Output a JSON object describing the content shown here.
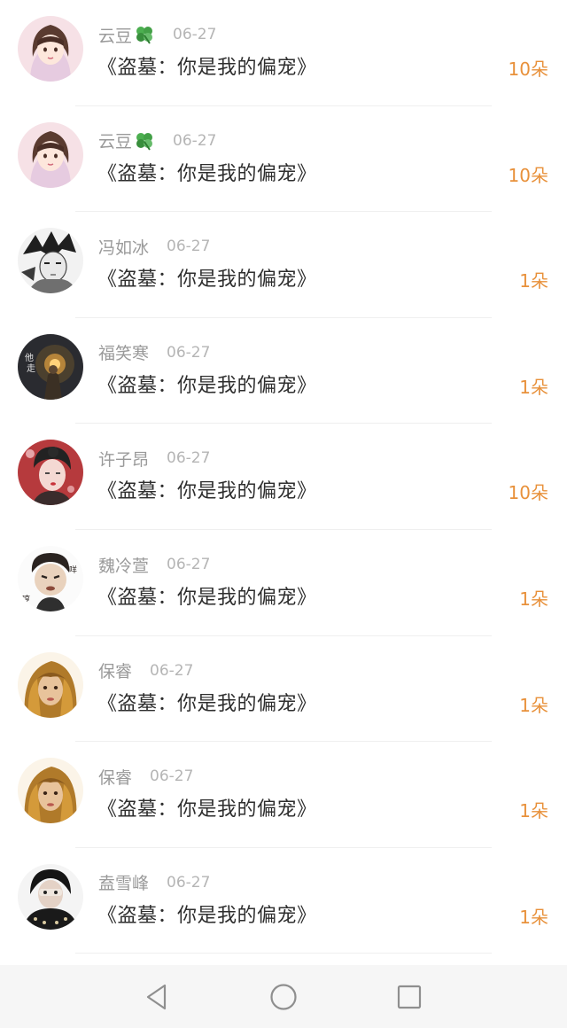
{
  "items": [
    {
      "name": "云豆",
      "has_clover": true,
      "date": "06-27",
      "title": "《盗墓：你是我的偏宠》",
      "count": "10朵",
      "avatar_icon": "anime-girl-avatar-icon"
    },
    {
      "name": "云豆",
      "has_clover": true,
      "date": "06-27",
      "title": "《盗墓：你是我的偏宠》",
      "count": "10朵",
      "avatar_icon": "anime-girl-avatar-icon"
    },
    {
      "name": "冯如冰",
      "has_clover": false,
      "date": "06-27",
      "title": "《盗墓：你是我的偏宠》",
      "count": "1朵",
      "avatar_icon": "sketch-boy-avatar-icon"
    },
    {
      "name": "福笑寒",
      "has_clover": false,
      "date": "06-27",
      "title": "《盗墓：你是我的偏宠》",
      "count": "1朵",
      "avatar_icon": "lantern-figure-avatar-icon"
    },
    {
      "name": "许子昂",
      "has_clover": false,
      "date": "06-27",
      "title": "《盗墓：你是我的偏宠》",
      "count": "10朵",
      "avatar_icon": "painted-lady-avatar-icon"
    },
    {
      "name": "魏冷萱",
      "has_clover": false,
      "date": "06-27",
      "title": "《盗墓：你是我的偏宠》",
      "count": "1朵",
      "avatar_icon": "cartoon-baby-avatar-icon"
    },
    {
      "name": "保睿",
      "has_clover": false,
      "date": "06-27",
      "title": "《盗墓：你是我的偏宠》",
      "count": "1朵",
      "avatar_icon": "blonde-woman-avatar-icon"
    },
    {
      "name": "保睿",
      "has_clover": false,
      "date": "06-27",
      "title": "《盗墓：你是我的偏宠》",
      "count": "1朵",
      "avatar_icon": "blonde-woman-avatar-icon"
    },
    {
      "name": "盍雪峰",
      "has_clover": false,
      "date": "06-27",
      "title": "《盗墓：你是我的偏宠》",
      "count": "1朵",
      "avatar_icon": "covered-face-avatar-icon"
    }
  ],
  "navbar": {
    "back_icon": "back-triangle-icon",
    "home_icon": "home-circle-icon",
    "recents_icon": "recents-square-icon"
  },
  "colors": {
    "count": "#e8913b",
    "name": "#9a9a9a",
    "date": "#b5b5b5",
    "title": "#2e2e2e",
    "navbar_bg": "#f6f6f6"
  }
}
